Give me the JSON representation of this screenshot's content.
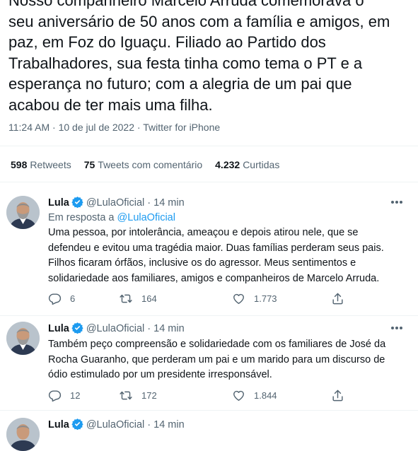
{
  "main_tweet": {
    "lines": [
      "Nosso companheiro Marcelo Arruda comemorava o",
      "seu aniversário de 50 anos com a família e amigos, em",
      "paz, em Foz do Iguaçu. Filiado ao Partido dos",
      "Trabalhadores, sua festa tinha como tema o PT e a",
      "esperança no futuro; com a alegria de um pai que",
      "acabou de ter mais uma filha."
    ],
    "time": "11:24 AM",
    "separator": "·",
    "date": "10 de jul de 2022",
    "source": "Twitter for iPhone"
  },
  "stats": {
    "retweets_count": "598",
    "retweets_label": "Retweets",
    "quotes_count": "75",
    "quotes_label": "Tweets com comentário",
    "likes_count": "4.232",
    "likes_label": "Curtidas"
  },
  "replies": [
    {
      "name": "Lula",
      "handle": "@LulaOficial",
      "separator": "·",
      "time": "14 min",
      "reply_prefix": "Em resposta a",
      "reply_handle": "@LulaOficial",
      "lines": [
        "Uma pessoa, por intolerância, ameaçou e depois atirou nele, que se",
        "defendeu e evitou uma tragédia maior. Duas famílias perderam seus pais.",
        "Filhos ficaram órfãos, inclusive os do agressor. Meus sentimentos e",
        "solidariedade aos familiares, amigos e companheiros de Marcelo Arruda."
      ],
      "replies_count": "6",
      "retweets_count": "164",
      "likes_count": "1.773"
    },
    {
      "name": "Lula",
      "handle": "@LulaOficial",
      "separator": "·",
      "time": "14 min",
      "lines": [
        "Também peço compreensão e solidariedade com os familiares de José da",
        "Rocha Guaranho, que perderam um pai e um marido para um discurso de",
        "ódio estimulado por um presidente irresponsável."
      ],
      "replies_count": "12",
      "retweets_count": "172",
      "likes_count": "1.844"
    },
    {
      "name": "Lula",
      "handle": "@LulaOficial",
      "separator": "·",
      "time": "14 min"
    }
  ],
  "icons": {
    "reply": "reply-icon",
    "retweet": "retweet-icon",
    "like": "like-icon",
    "share": "share-icon",
    "verified": "verified-badge-icon",
    "more": "more-icon"
  },
  "colors": {
    "text": "#0f1419",
    "secondary": "#536471",
    "link": "#1d9bf0",
    "divider": "#eff3f4"
  }
}
